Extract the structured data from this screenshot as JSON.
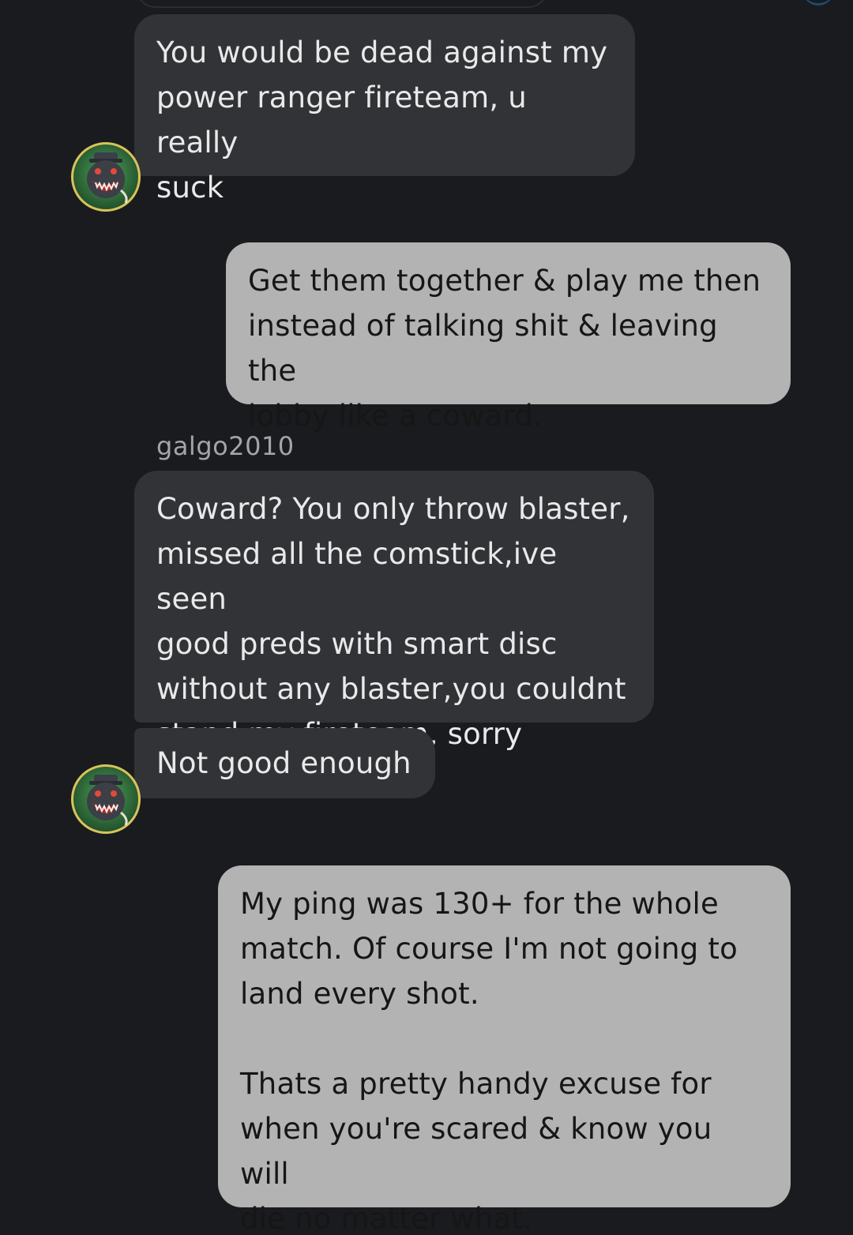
{
  "conversation": {
    "messages": [
      {
        "direction": "incoming",
        "text": "You would be dead against my\npower ranger fireteam, u really\nsuck"
      },
      {
        "direction": "outgoing",
        "text": "Get them together & play me then\ninstead of talking shit & leaving the\nlobby like a coward."
      },
      {
        "direction": "incoming",
        "sender": "galgo2010",
        "text": "Coward? You only throw blaster,\nmissed all the comstick,ive seen\ngood preds with smart disc\nwithout any blaster,you couldnt\nstand my fireteam, sorry"
      },
      {
        "direction": "incoming",
        "text": "Not good enough"
      },
      {
        "direction": "outgoing",
        "text": "My ping was 130+ for the whole\nmatch. Of course I'm not going to\nland every shot.\n\nThats a pretty handy excuse for\nwhen you're scared & know you will\ndie no matter what."
      }
    ]
  },
  "avatar": {
    "icon": "monster-avatar-icon",
    "ring_color": "#d8c35a",
    "background_color": "#2f6b3a"
  },
  "colors": {
    "background": "#1a1b1e",
    "incoming_bubble": "#323336",
    "outgoing_bubble": "#b3b3b3",
    "incoming_text": "#e9e9ea",
    "outgoing_text": "#161616",
    "sender_name": "#a4a5a8"
  }
}
